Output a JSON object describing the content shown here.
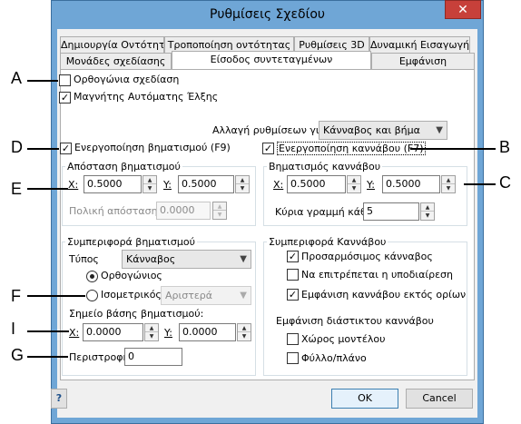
{
  "window": {
    "title": "Ρυθμίσεις Σχεδίου",
    "close_glyph": "✕"
  },
  "tabs_row1": [
    "Δημιουργία Οντότητας",
    "Τροποποίηση οντότητας",
    "Ρυθμίσεις 3D",
    "Δυναμική Εισαγωγή"
  ],
  "tabs_row2": [
    "Μονάδες σχεδίασης",
    "Είσοδος συντεταγμένων",
    "Εμφάνιση"
  ],
  "top": {
    "ortho": "Ορθογώνια σχεδίαση",
    "magnet": "Μαγνήτης Αυτόματης Έλξης",
    "change_settings_label": "Αλλαγή ρυθμίσεων για",
    "change_settings_value": "Κάνναβος και βήμα"
  },
  "snap": {
    "enable": "Ενεργοποίηση βηματισμού (F9)",
    "distance_title": "Απόσταση βηματισμού",
    "x_label": "X:",
    "x_value": "0.5000",
    "y_label": "Y:",
    "y_value": "0.5000",
    "polar_label": "Πολική απόσταση:",
    "polar_value": "0.0000",
    "behavior_title": "Συμπεριφορά βηματισμού",
    "type_label": "Τύπος",
    "type_value": "Κάνναβος",
    "ortho_option": "Ορθογώνιος",
    "iso_option": "Ισομετρικός",
    "iso_value": "Αριστερά",
    "base_label": "Σημείο βάσης βηματισμού:",
    "base_x_label": "X:",
    "base_x_value": "0.0000",
    "base_y_label": "Y:",
    "base_y_value": "0.0000",
    "rotation_label": "Περιστροφή",
    "rotation_value": "0"
  },
  "grid": {
    "enable": "Ενεργοποίηση καννάβου (F7)",
    "spacing_title": "Βηματισμός καννάβου",
    "x_label": "X:",
    "x_value": "0.5000",
    "y_label": "Y:",
    "y_value": "0.5000",
    "major_label": "Κύρια γραμμή κάθε",
    "major_value": "5",
    "behavior_title": "Συμπεριφορά Καννάβου",
    "adaptive": "Προσαρμόσιμος κάνναβος",
    "subdivide": "Να επιτρέπεται η υποδιαίρεση",
    "beyond_limits": "Εμφάνιση καννάβου εκτός ορίων",
    "dots_title": "Εμφάνιση διάστικτου καννάβου",
    "model_space": "Χώρος μοντέλου",
    "sheet": "Φύλλο/πλάνο"
  },
  "buttons": {
    "help": "?",
    "ok": "OK",
    "cancel": "Cancel"
  },
  "callouts": {
    "A": "A",
    "B": "B",
    "C": "C",
    "D": "D",
    "E": "E",
    "F": "F",
    "G": "G",
    "I": "I"
  },
  "state": {
    "ortho_checked": false,
    "magnet_checked": true,
    "snap_enabled": true,
    "grid_enabled": true,
    "adaptive_checked": true,
    "subdivide_checked": false,
    "beyond_checked": true,
    "model_checked": false,
    "sheet_checked": false,
    "snap_type_selected": "Ορθογώνιος"
  }
}
